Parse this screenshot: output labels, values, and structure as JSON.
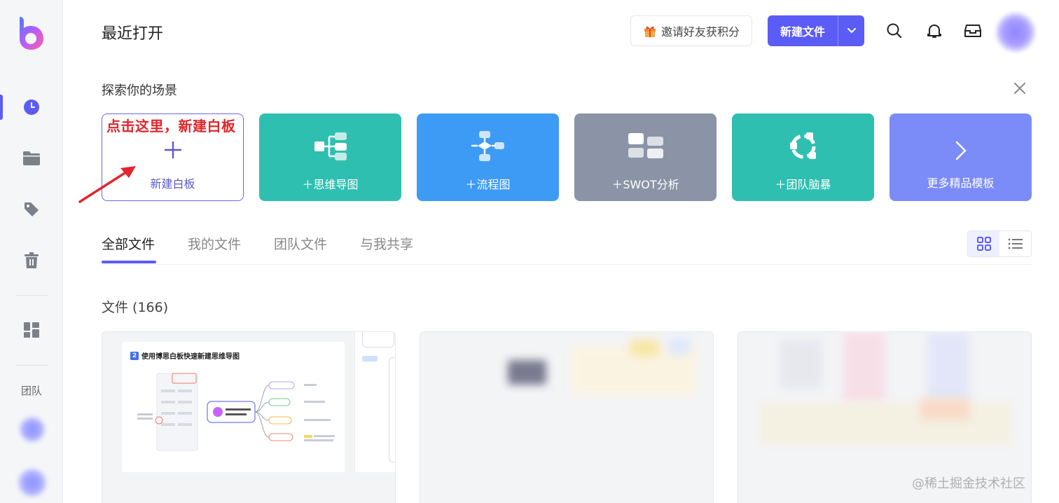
{
  "header": {
    "title": "最近打开",
    "invite_label": "邀请好友获积分",
    "new_file_label": "新建文件"
  },
  "sidebar": {
    "team_label": "团队",
    "items": [
      {
        "name": "recent",
        "icon": "clock-icon"
      },
      {
        "name": "folder",
        "icon": "folder-icon"
      },
      {
        "name": "tags",
        "icon": "tag-icon"
      },
      {
        "name": "trash",
        "icon": "trash-icon"
      },
      {
        "name": "templates",
        "icon": "grid-icon"
      }
    ]
  },
  "explore": {
    "title": "探索你的场景",
    "hint": "点击这里，新建白板",
    "cards": [
      {
        "label": "新建白板",
        "color": "#ffffff"
      },
      {
        "label": "＋思维导图",
        "color": "#2fbfb0"
      },
      {
        "label": "＋流程图",
        "color": "#3d9bf5"
      },
      {
        "label": "＋SWOT分析",
        "color": "#8a94a6"
      },
      {
        "label": "＋团队脑暴",
        "color": "#2fbfb0"
      },
      {
        "label": "更多精品模板",
        "color": "#7b8cf8"
      }
    ]
  },
  "tabs": [
    {
      "label": "全部文件",
      "active": true
    },
    {
      "label": "我的文件",
      "active": false
    },
    {
      "label": "团队文件",
      "active": false
    },
    {
      "label": "与我共享",
      "active": false
    }
  ],
  "files": {
    "count_label": "文件 (166)",
    "first_card_title": "使用博思白板快速新建思维导图",
    "first_card_badge": "2"
  },
  "watermark": "@稀土掘金技术社区",
  "colors": {
    "accent": "#5b5bf6",
    "hint_red": "#e0262c"
  }
}
